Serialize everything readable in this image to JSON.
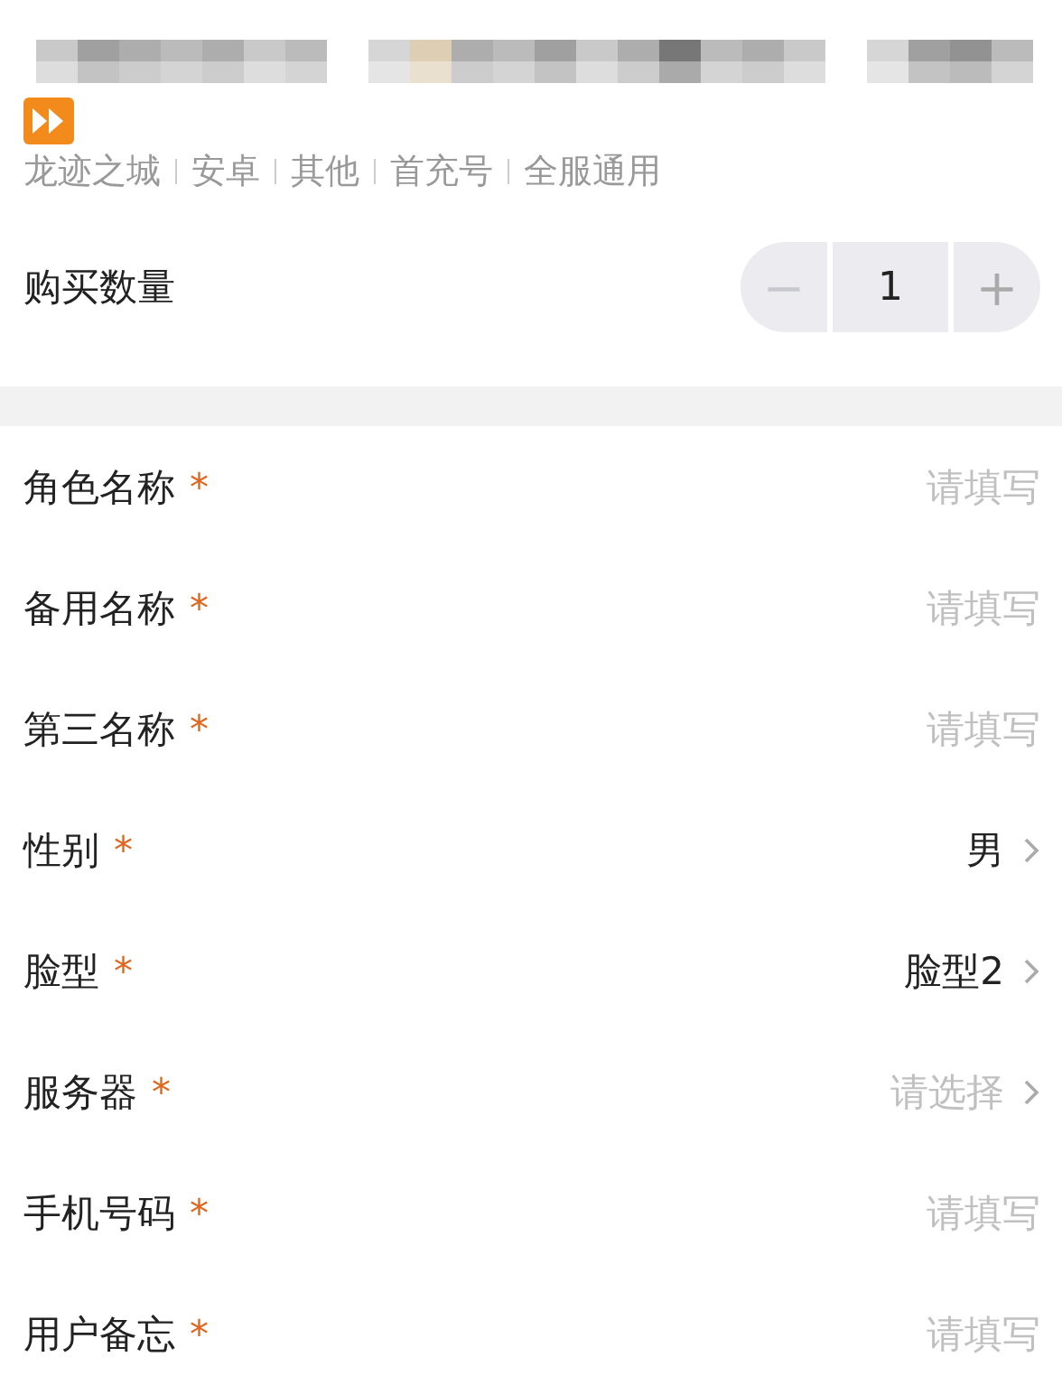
{
  "product": {
    "tags": [
      "龙迹之城",
      "安卓",
      "其他",
      "首充号",
      "全服通用"
    ]
  },
  "quantity": {
    "label": "购买数量",
    "minus": "−",
    "value": "1",
    "plus": "+",
    "minus_disabled": true
  },
  "fields": [
    {
      "kind": "input",
      "label": "角色名称",
      "required_mark": "*",
      "placeholder": "请填写"
    },
    {
      "kind": "input",
      "label": "备用名称",
      "required_mark": "*",
      "placeholder": "请填写"
    },
    {
      "kind": "input",
      "label": "第三名称",
      "required_mark": "*",
      "placeholder": "请填写"
    },
    {
      "kind": "select",
      "label": "性别",
      "required_mark": "*",
      "value": "男"
    },
    {
      "kind": "select",
      "label": "脸型",
      "required_mark": "*",
      "value": "脸型2"
    },
    {
      "kind": "select",
      "label": "服务器",
      "required_mark": "*",
      "placeholder": "请选择"
    },
    {
      "kind": "input",
      "label": "手机号码",
      "required_mark": "*",
      "placeholder": "请填写"
    },
    {
      "kind": "input",
      "label": "用户备忘",
      "required_mark": "*",
      "placeholder": "请填写"
    }
  ]
}
